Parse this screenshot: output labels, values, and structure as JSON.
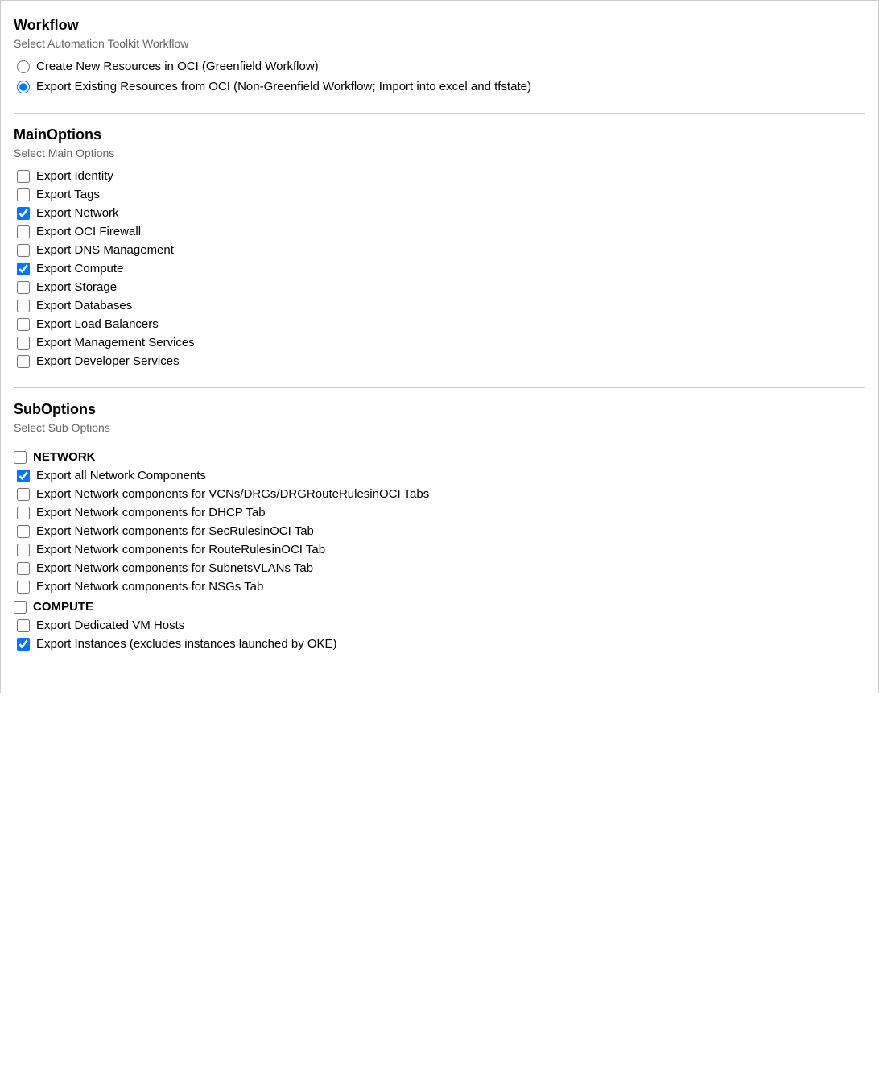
{
  "workflow": {
    "title": "Workflow",
    "subtitle": "Select Automation Toolkit Workflow",
    "options": [
      {
        "id": "greenfield",
        "label": "Create New Resources in OCI (Greenfield Workflow)",
        "checked": false
      },
      {
        "id": "non-greenfield",
        "label": "Export Existing Resources from OCI (Non-Greenfield Workflow; Import into excel and tfstate)",
        "checked": true
      }
    ]
  },
  "main_options": {
    "title": "MainOptions",
    "subtitle": "Select Main Options",
    "items": [
      {
        "id": "export-identity",
        "label": "Export Identity",
        "checked": false
      },
      {
        "id": "export-tags",
        "label": "Export Tags",
        "checked": false
      },
      {
        "id": "export-network",
        "label": "Export Network",
        "checked": true
      },
      {
        "id": "export-oci-firewall",
        "label": "Export OCI Firewall",
        "checked": false
      },
      {
        "id": "export-dns-management",
        "label": "Export DNS Management",
        "checked": false
      },
      {
        "id": "export-compute",
        "label": "Export Compute",
        "checked": true
      },
      {
        "id": "export-storage",
        "label": "Export Storage",
        "checked": false
      },
      {
        "id": "export-databases",
        "label": "Export Databases",
        "checked": false
      },
      {
        "id": "export-load-balancers",
        "label": "Export Load Balancers",
        "checked": false
      },
      {
        "id": "export-management-services",
        "label": "Export Management Services",
        "checked": false
      },
      {
        "id": "export-developer-services",
        "label": "Export Developer Services",
        "checked": false
      }
    ]
  },
  "sub_options": {
    "title": "SubOptions",
    "subtitle": "Select Sub Options",
    "groups": [
      {
        "id": "network-group",
        "label": "NETWORK",
        "group_checked": false,
        "items": [
          {
            "id": "export-all-network",
            "label": "Export all Network Components",
            "checked": true
          },
          {
            "id": "export-vcns-drgs",
            "label": "Export Network components for VCNs/DRGs/DRGRouteRulesinOCI Tabs",
            "checked": false
          },
          {
            "id": "export-dhcp",
            "label": "Export Network components for DHCP Tab",
            "checked": false
          },
          {
            "id": "export-secrules",
            "label": "Export Network components for SecRulesinOCI Tab",
            "checked": false
          },
          {
            "id": "export-routerules",
            "label": "Export Network components for RouteRulesinOCI Tab",
            "checked": false
          },
          {
            "id": "export-subnetsvlans",
            "label": "Export Network components for SubnetsVLANs Tab",
            "checked": false
          },
          {
            "id": "export-nsgs",
            "label": "Export Network components for NSGs Tab",
            "checked": false
          }
        ]
      },
      {
        "id": "compute-group",
        "label": "COMPUTE",
        "group_checked": false,
        "items": [
          {
            "id": "export-dedicated-vm",
            "label": "Export Dedicated VM Hosts",
            "checked": false
          },
          {
            "id": "export-instances",
            "label": "Export Instances (excludes instances launched by OKE)",
            "checked": true
          }
        ]
      }
    ]
  }
}
